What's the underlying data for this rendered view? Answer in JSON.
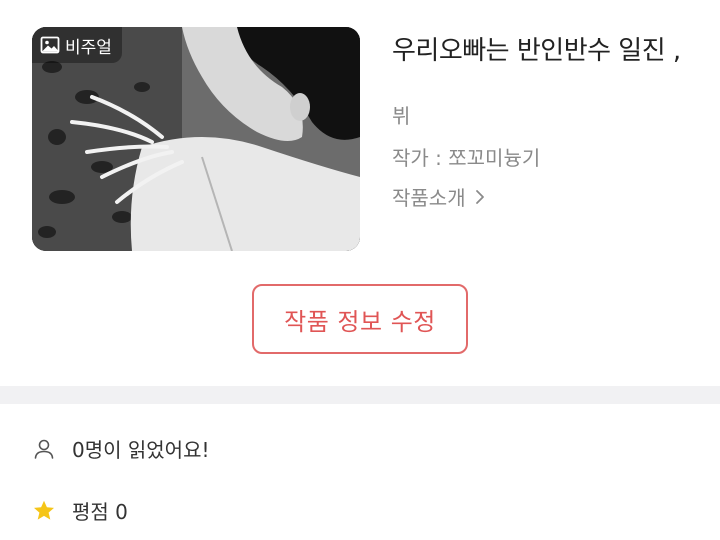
{
  "work": {
    "title": "우리오빠는 반인반수 일진 ,",
    "genre": "뷔",
    "author": "작가 : 쪼꼬미늉기",
    "intro_label": "작품소개",
    "cover_badge": "비주얼"
  },
  "actions": {
    "edit_label": "작품 정보 수정"
  },
  "stats": {
    "readers": "0명이 읽었어요!",
    "rating": "평점 0"
  },
  "colors": {
    "accent": "#e05555",
    "star": "#f5c518",
    "muted_text": "#8a8a8a",
    "divider": "#f1f1f3"
  },
  "icons": {
    "badge": "image-icon",
    "intro": "chevron-right-icon",
    "readers": "person-icon",
    "rating": "star-icon"
  }
}
